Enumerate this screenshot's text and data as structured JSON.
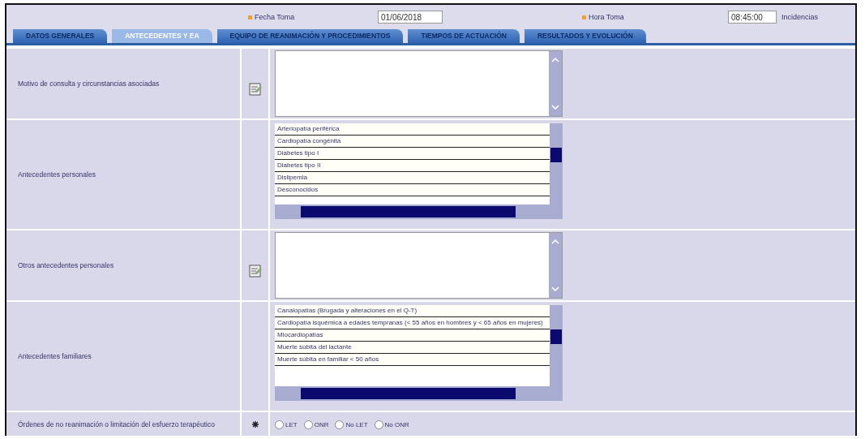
{
  "header": {
    "date_label": "Fecha Toma",
    "date_value": "01/06/2018",
    "time_label": "Hora Toma",
    "time_value": "08:45:00",
    "note": "Incidencias"
  },
  "tabs": [
    {
      "label": "DATOS GENERALES",
      "selected": false
    },
    {
      "label": "ANTECEDENTES Y EA",
      "selected": true
    },
    {
      "label": "EQUIPO DE REANIMACIÓN Y PROCEDIMIENTOS",
      "selected": false
    },
    {
      "label": "TIEMPOS DE ACTUACIÓN",
      "selected": false
    },
    {
      "label": "RESULTADOS Y EVOLUCIÓN",
      "selected": false
    }
  ],
  "rows": [
    {
      "kind": "text",
      "label": "Motivo de consulta y circunstancias asociadas"
    },
    {
      "kind": "list",
      "label": "Antecedentes personales",
      "options": [
        "Arteriopatía periférica",
        "Cardiopatía congénita",
        "Diabetes tipo I",
        "Diabetes tipo II",
        "Dislipemia",
        "Desconocidos"
      ]
    },
    {
      "kind": "text",
      "label": "Otros antecedentes personales"
    },
    {
      "kind": "list",
      "label": "Antecedentes familiares",
      "options": [
        "Canalopatías (Brugada y alteraciones en el Q-T)",
        "Cardiopatía isquémica a edades tempranas (< 55 años en hombres y < 65 años en mujeres)",
        "Miocardiopatías",
        "Muerte súbita del lactante",
        "Muerte súbita en familiar < 50 años"
      ]
    },
    {
      "kind": "radio",
      "label": "Órdenes de no reanimación o limitación del esfuerzo terapéutico",
      "options": [
        {
          "label": "LET",
          "selected": false
        },
        {
          "label": "ONR",
          "selected": false
        },
        {
          "label": "No LET",
          "selected": false
        },
        {
          "label": "No ONR",
          "selected": false
        }
      ]
    }
  ]
}
